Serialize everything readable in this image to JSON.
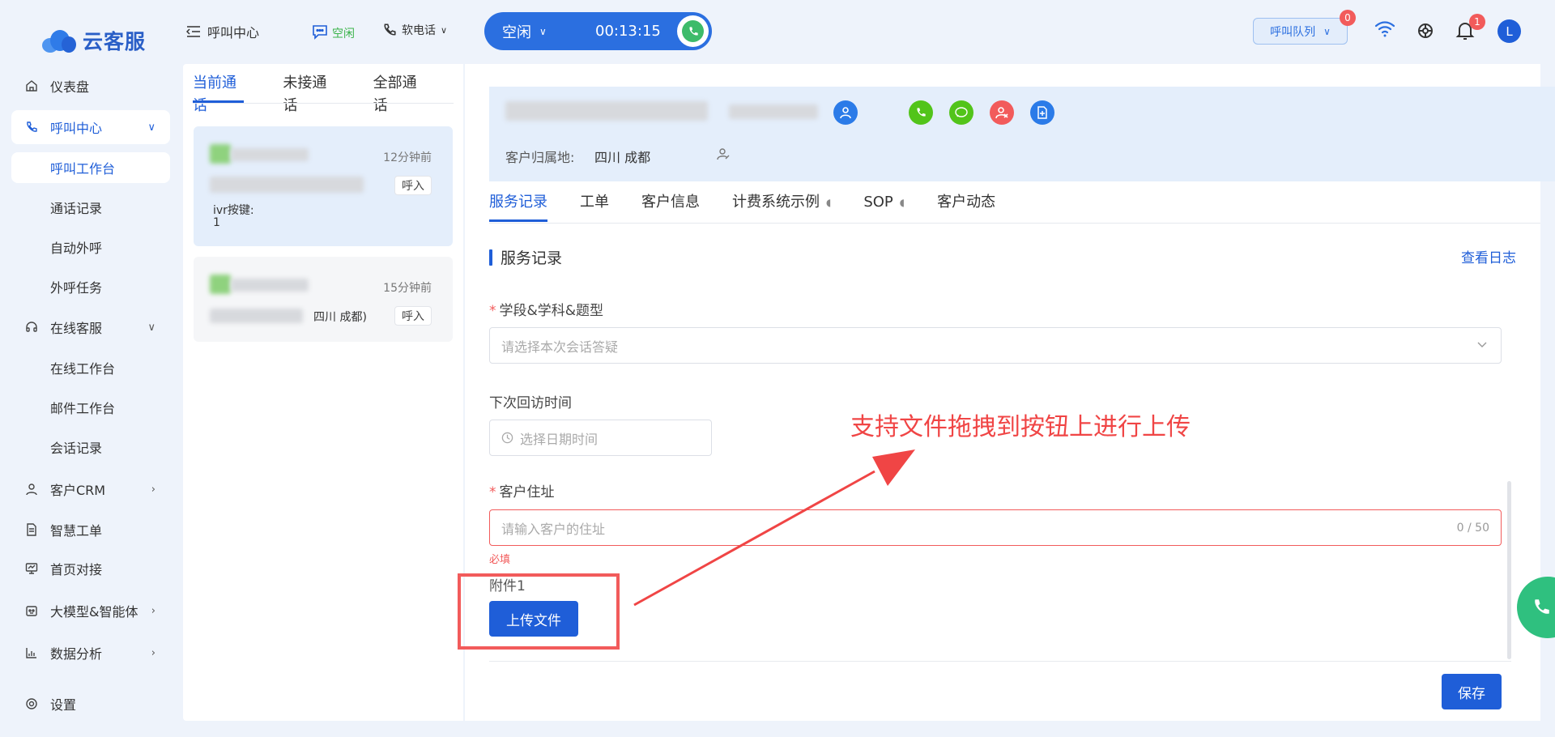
{
  "brand": {
    "name": "云客服"
  },
  "colors": {
    "accent": "#1f5ed8",
    "danger": "#f25b5b",
    "success": "#52c41a"
  },
  "topbar": {
    "menu_toggle_label": "呼叫中心",
    "agent_status": "空闲",
    "phone_mode": "软电话",
    "call_state": "空闲",
    "call_timer": "00:13:15",
    "queue_label": "呼叫队列",
    "queue_badge": "0",
    "notification_badge": "1",
    "user_initial": "L"
  },
  "sidebar": {
    "items": [
      {
        "label": "仪表盘",
        "icon": "home-icon"
      },
      {
        "label": "呼叫中心",
        "icon": "phone-icon"
      },
      {
        "label": "在线客服",
        "icon": "headset-icon"
      },
      {
        "label": "客户CRM",
        "icon": "user-icon"
      },
      {
        "label": "智慧工单",
        "icon": "document-icon"
      },
      {
        "label": "首页对接",
        "icon": "monitor-icon"
      },
      {
        "label": "大模型&智能体",
        "icon": "robot-icon"
      },
      {
        "label": "数据分析",
        "icon": "bar-chart-icon"
      },
      {
        "label": "设置",
        "icon": "gear-icon"
      }
    ],
    "call_center_sub": [
      "呼叫工作台",
      "通话记录",
      "自动外呼",
      "外呼任务"
    ],
    "online_service_sub": [
      "在线工作台",
      "邮件工作台",
      "会话记录"
    ]
  },
  "calls": {
    "tabs": [
      "当前通话",
      "未接通话",
      "全部通话"
    ],
    "list": [
      {
        "time_ago": "12分钟前",
        "direction": "呼入",
        "ivr_label": "ivr按键:",
        "ivr_value": "1"
      },
      {
        "time_ago": "15分钟前",
        "direction": "呼入",
        "location_suffix": "四川 成都)"
      }
    ]
  },
  "customer": {
    "location_label": "客户归属地:",
    "location_value": "四川 成都"
  },
  "detail_tabs": [
    {
      "label": "服务记录"
    },
    {
      "label": "工单"
    },
    {
      "label": "客户信息"
    },
    {
      "label": "计费系统示例"
    },
    {
      "label": "SOP"
    },
    {
      "label": "客户动态"
    }
  ],
  "form": {
    "section_title": "服务记录",
    "log_link": "查看日志",
    "subject_label": "学段&学科&题型",
    "subject_placeholder": "请选择本次会话答疑",
    "revisit_label": "下次回访时间",
    "revisit_placeholder": "选择日期时间",
    "address_label": "客户住址",
    "address_placeholder": "请输入客户的住址",
    "address_counter": "0 / 50",
    "address_error": "必填",
    "attachment_label": "附件1",
    "upload_button": "上传文件",
    "save_button": "保存"
  },
  "annotation": {
    "text": "支持文件拖拽到按钮上进行上传"
  }
}
